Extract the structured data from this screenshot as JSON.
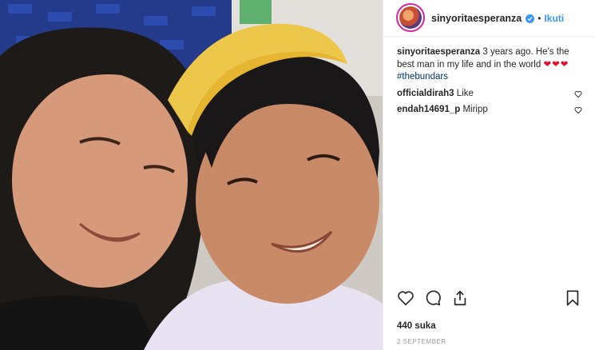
{
  "post": {
    "username": "sinyoritaesperanza",
    "separator": "•",
    "follow_label": "Ikuti",
    "caption": {
      "username": "sinyoritaesperanza",
      "text": "3 years ago. He's the best man in my life and in the world",
      "emoji": "❤❤❤",
      "hashtag": "#thebundars"
    },
    "comments": [
      {
        "username": "officialdirah3",
        "text": "Like"
      },
      {
        "username": "endah14691_p",
        "text": "Miripp"
      }
    ],
    "likes": "440 suka",
    "date": "2 SEPTEMBER"
  },
  "colors": {
    "accent": "#3897f0",
    "heart": "#e0112b",
    "hashtag": "#003569",
    "muted": "#999999"
  },
  "icons": {
    "like": "heart-outline-icon",
    "comment": "comment-bubble-icon",
    "share": "share-icon",
    "save": "bookmark-icon",
    "verified": "verified-badge-icon"
  }
}
